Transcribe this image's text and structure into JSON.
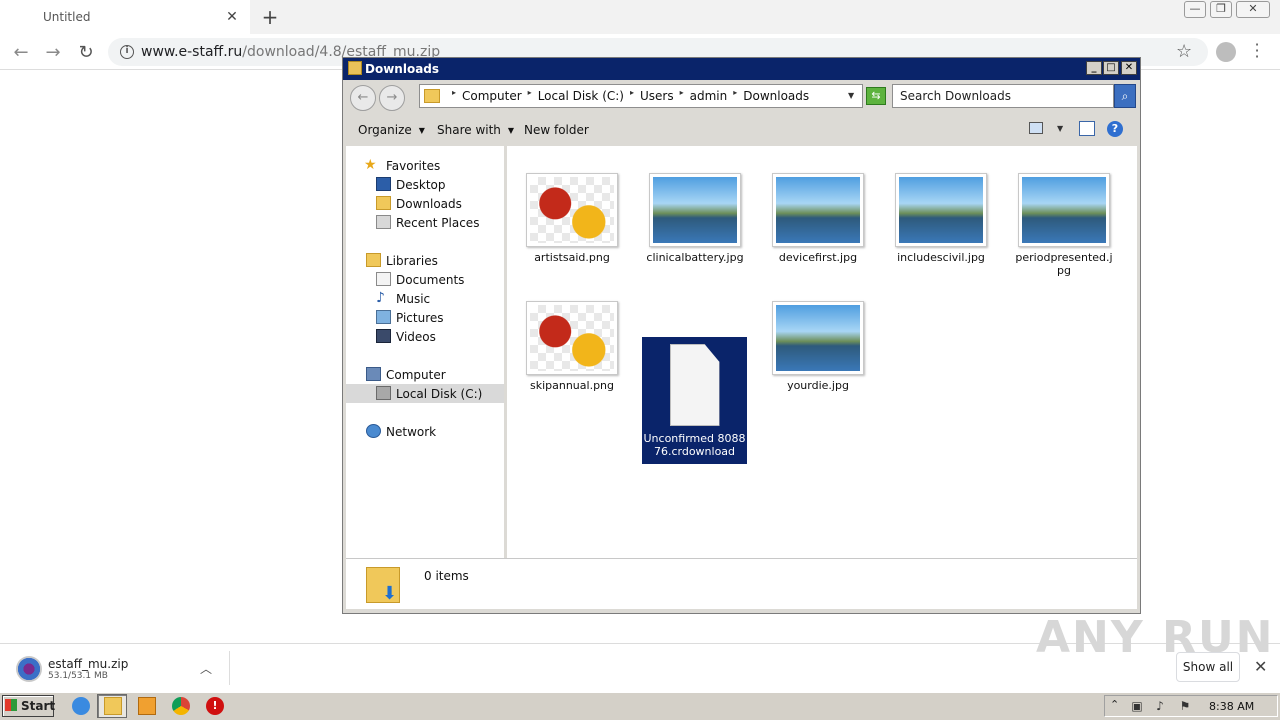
{
  "browser": {
    "tab_title": "Untitled",
    "url_host": "www.e-staff.ru",
    "url_path": "/download/4.8/estaff_mu.zip"
  },
  "explorer": {
    "title": "Downloads",
    "breadcrumb": [
      "Computer",
      "Local Disk (C:)",
      "Users",
      "admin",
      "Downloads"
    ],
    "search_placeholder": "Search Downloads",
    "commands": {
      "organize": "Organize",
      "share_with": "Share with",
      "new_folder": "New folder"
    },
    "nav": {
      "favorites": "Favorites",
      "desktop": "Desktop",
      "downloads": "Downloads",
      "recent_places": "Recent Places",
      "libraries": "Libraries",
      "documents": "Documents",
      "music": "Music",
      "pictures": "Pictures",
      "videos": "Videos",
      "computer": "Computer",
      "local_disk": "Local Disk (C:)",
      "network": "Network"
    },
    "files": [
      {
        "name": "artistsaid.png",
        "thumb": "flower"
      },
      {
        "name": "clinicalbattery.jpg",
        "thumb": "landscape"
      },
      {
        "name": "devicefirst.jpg",
        "thumb": "landscape"
      },
      {
        "name": "includescivil.jpg",
        "thumb": "landscape"
      },
      {
        "name": "periodpresented.jpg",
        "thumb": "landscape"
      },
      {
        "name": "skipannual.png",
        "thumb": "flower"
      },
      {
        "name": "Unconfirmed 808876.crdownload",
        "thumb": "document",
        "selected": true
      },
      {
        "name": "yourdie.jpg",
        "thumb": "landscape"
      }
    ],
    "status": "0 items"
  },
  "download_shelf": {
    "file_name": "estaff_mu.zip",
    "progress": "53.1/53.1 MB",
    "show_all": "Show all"
  },
  "taskbar": {
    "start": "Start",
    "clock": "8:38 AM"
  },
  "watermark": "ANY RUN"
}
